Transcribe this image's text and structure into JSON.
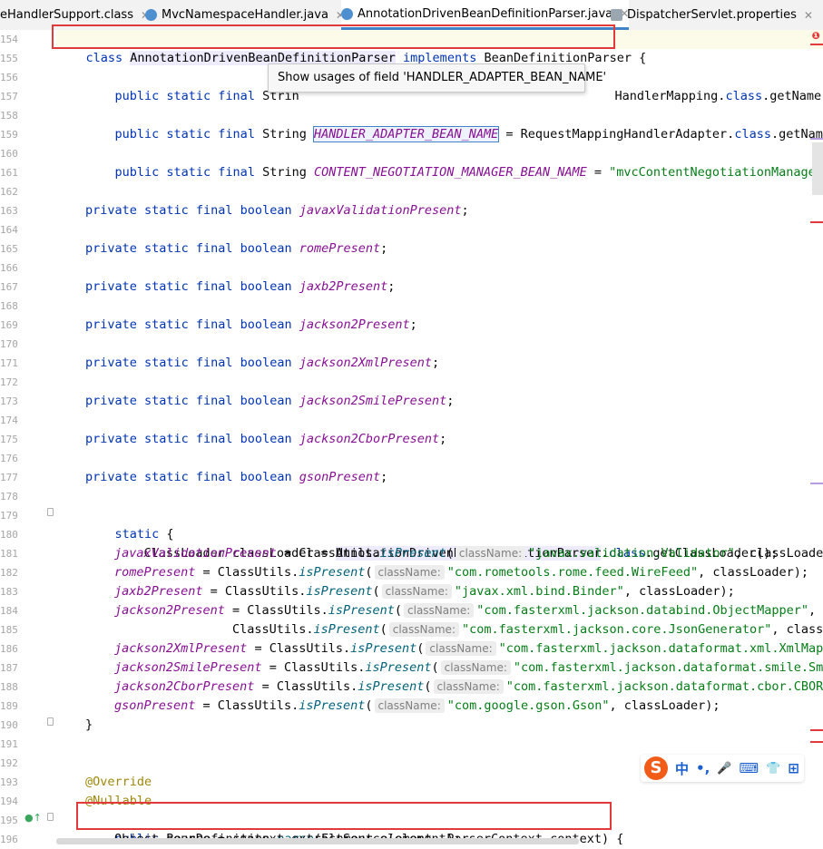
{
  "tabs": [
    {
      "label": "eHandlerSupport.class",
      "icon": "class-file-icon",
      "active": false
    },
    {
      "label": "MvcNamespaceHandler.java",
      "icon": "java-class-icon",
      "active": false
    },
    {
      "label": "AnnotationDrivenBeanDefinitionParser.java",
      "icon": "java-class-icon",
      "active": true
    },
    {
      "label": "DispatcherServlet.properties",
      "icon": "properties-file-icon",
      "active": false
    }
  ],
  "tooltip": "Show usages of field 'HANDLER_ADAPTER_BEAN_NAME'",
  "line_numbers": [
    "154",
    "155",
    "156",
    "157",
    "158",
    "159",
    "160",
    "161",
    "162",
    "163",
    "164",
    "165",
    "166",
    "167",
    "168",
    "169",
    "170",
    "171",
    "172",
    "173",
    "174",
    "175",
    "176",
    "177",
    "178",
    "179",
    "180",
    "181",
    "182",
    "183",
    "184",
    "185",
    "186",
    "187",
    "188",
    "189",
    "190",
    "191",
    "192",
    "193",
    "194",
    "195",
    "196"
  ],
  "code": {
    "l154": {
      "kw1": "class",
      "cls": "AnnotationDrivenBeanDefinitionParser",
      "kw2": "implements",
      "iface": "BeanDefinitionParser",
      "brace": "{"
    },
    "l156": {
      "kw": "public static final",
      "type": "Strin",
      "rest": "HandlerMapping.",
      "kwcls": "class",
      "tail": ".getName();"
    },
    "l158": {
      "kw": "public static final",
      "type": "String",
      "field": "HANDLER_ADAPTER_BEAN_NAME",
      "rest": " = RequestMappingHandlerAdapter.",
      "kwcls": "class",
      "tail": ".getName();"
    },
    "l160": {
      "kw": "public static final",
      "type": "String",
      "field": "CONTENT_NEGOTIATION_MANAGER_BEAN_NAME",
      "eq": " = ",
      "str": "\"mvcContentNegotiationManager\"",
      "semi": ";"
    },
    "bools": [
      {
        "kw": "private static final boolean",
        "field": "javaxValidationPresent",
        "semi": ";"
      },
      {
        "kw": "private static final boolean",
        "field": "romePresent",
        "semi": ";"
      },
      {
        "kw": "private static final boolean",
        "field": "jaxb2Present",
        "semi": ";"
      },
      {
        "kw": "private static final boolean",
        "field": "jackson2Present",
        "semi": ";"
      },
      {
        "kw": "private static final boolean",
        "field": "jackson2XmlPresent",
        "semi": ";"
      },
      {
        "kw": "private static final boolean",
        "field": "jackson2SmilePresent",
        "semi": ";"
      },
      {
        "kw": "private static final boolean",
        "field": "jackson2CborPresent",
        "semi": ";"
      },
      {
        "kw": "private static final boolean",
        "field": "gsonPresent",
        "semi": ";"
      }
    ],
    "l179": {
      "kw": "static",
      "brace": " {"
    },
    "l180": {
      "a": "ClassLoader classLoader = ",
      "b": "AnnotationDrivenBeanDefinitionParser",
      "c": ".",
      "kw": "class",
      "d": ".getClassLoader();"
    },
    "assigns": [
      {
        "field": "javaxValidationPresent",
        "mid": " = ClassUtils.",
        "m": "isPresent",
        "p": "(",
        "hint": "className:",
        "str": "\"javax.validation.Validator\"",
        "tail": ", classLoader);"
      },
      {
        "field": "romePresent",
        "mid": " = ClassUtils.",
        "m": "isPresent",
        "p": "(",
        "hint": "className:",
        "str": "\"com.rometools.rome.feed.WireFeed\"",
        "tail": ", classLoader);"
      },
      {
        "field": "jaxb2Present",
        "mid": " = ClassUtils.",
        "m": "isPresent",
        "p": "(",
        "hint": "className:",
        "str": "\"javax.xml.bind.Binder\"",
        "tail": ", classLoader);"
      },
      {
        "field": "jackson2Present",
        "mid": " = ClassUtils.",
        "m": "isPresent",
        "p": "(",
        "hint": "className:",
        "str": "\"com.fasterxml.jackson.databind.ObjectMapper\"",
        "tail": ", cl"
      },
      {
        "field": "",
        "mid": "                ClassUtils.",
        "m": "isPresent",
        "p": "(",
        "hint": "className:",
        "str": "\"com.fasterxml.jackson.core.JsonGenerator\"",
        "tail": ", classLo"
      },
      {
        "field": "jackson2XmlPresent",
        "mid": " = ClassUtils.",
        "m": "isPresent",
        "p": "(",
        "hint": "className:",
        "str": "\"com.fasterxml.jackson.dataformat.xml.XmlMappe",
        "tail": ""
      },
      {
        "field": "jackson2SmilePresent",
        "mid": " = ClassUtils.",
        "m": "isPresent",
        "p": "(",
        "hint": "className:",
        "str": "\"com.fasterxml.jackson.dataformat.smile.Smil",
        "tail": ""
      },
      {
        "field": "jackson2CborPresent",
        "mid": " = ClassUtils.",
        "m": "isPresent",
        "p": "(",
        "hint": "className:",
        "str": "\"com.fasterxml.jackson.dataformat.cbor.CBORFa",
        "tail": ""
      },
      {
        "field": "gsonPresent",
        "mid": " = ClassUtils.",
        "m": "isPresent",
        "p": "(",
        "hint": "className:",
        "str": "\"com.google.gson.Gson\"",
        "tail": ", classLoader);"
      }
    ],
    "l190": "}",
    "l193": "@Override",
    "l194": "@Nullable",
    "l195": {
      "kw": "public",
      "a": " BeanDefinition ",
      "m": "parse",
      "b": "(Element element, ParserContext context) {"
    },
    "l196": "Object source = context.extractSource(element);"
  },
  "ime": {
    "logo": "S",
    "items": [
      "中",
      "•,",
      "🎤",
      "⌨",
      "👕",
      "⊞"
    ]
  },
  "colors": {
    "highlight_box": "#e23a3a",
    "selection": "#4083c9"
  }
}
